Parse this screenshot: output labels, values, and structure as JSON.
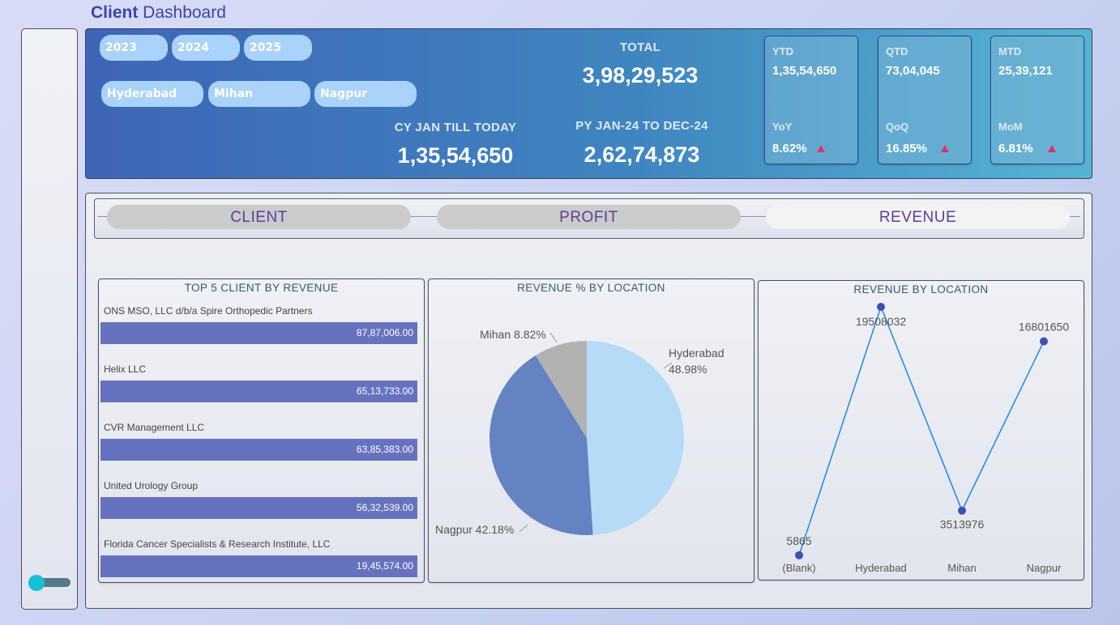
{
  "header": {
    "title_bold": "Client",
    "title_rest": " Dashboard"
  },
  "filters": {
    "years": [
      "2023",
      "2024",
      "2025"
    ],
    "locations": [
      "Hyderabad",
      "Mihan",
      "Nagpur"
    ]
  },
  "totals": {
    "total_label": "TOTAL",
    "total_value": "3,98,29,523",
    "cy_label": "CY JAN TILL TODAY",
    "cy_value": "1,35,54,650",
    "py_label": "PY JAN-24 TO DEC-24",
    "py_value": "2,62,74,873"
  },
  "kpis": [
    {
      "label": "YTD",
      "value": "1,35,54,650",
      "change_label": "YoY",
      "change_value": "8.62%"
    },
    {
      "label": "QTD",
      "value": "73,04,045",
      "change_label": "QoQ",
      "change_value": "16.85%"
    },
    {
      "label": "MTD",
      "value": "25,39,121",
      "change_label": "MoM",
      "change_value": "6.81%"
    }
  ],
  "tabs": {
    "client": "CLIENT",
    "profit": "PROFIT",
    "revenue": "REVENUE",
    "active": "REVENUE"
  },
  "colors": {
    "accent": "#3a45a8",
    "bar": "#6772bf",
    "trend_up": "#e0326a",
    "line": "#1e88e5",
    "point": "#3f4fb0"
  },
  "chart_data": [
    {
      "type": "bar",
      "title": "TOP 5 CLIENT BY REVENUE",
      "categories": [
        "ONS MSO, LLC d/b/a Spire Orthopedic Partners",
        "Helix LLC",
        "CVR Management LLC",
        "United Urology Group",
        "Florida Cancer Specialists & Research Institute, LLC"
      ],
      "values": [
        8787006.0,
        6513733.0,
        6385383.0,
        5632539.0,
        1945574.0
      ],
      "labels": [
        "87,87,006.00",
        "65,13,733.00",
        "63,85,383.00",
        "56,32,539.00",
        "19,45,574.00"
      ],
      "orientation": "horizontal"
    },
    {
      "type": "pie",
      "title": "REVENUE % BY LOCATION",
      "slices": [
        {
          "name": "Hyderabad",
          "value": 48.98,
          "label": "48.98%",
          "color": "#b6dbf6"
        },
        {
          "name": "Nagpur",
          "value": 42.18,
          "label": "42.18%",
          "color": "#6383c3"
        },
        {
          "name": "Mihan",
          "value": 8.82,
          "label": "8.82%",
          "color": "#b2b2b2"
        }
      ]
    },
    {
      "type": "line",
      "title": "REVENUE BY LOCATION",
      "categories": [
        "(Blank)",
        "Hyderabad",
        "Mihan",
        "Nagpur"
      ],
      "values": [
        5865,
        19508032,
        3513976,
        16801650
      ],
      "ylim": [
        0,
        19508032
      ]
    }
  ]
}
